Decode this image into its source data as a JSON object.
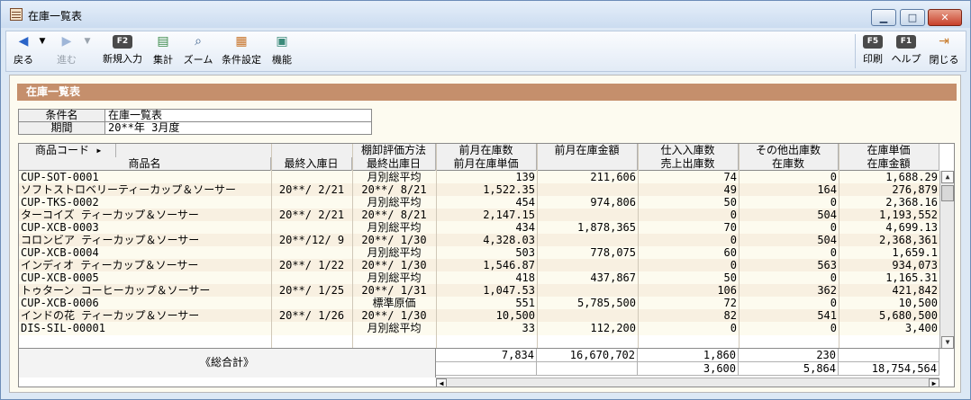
{
  "window": {
    "title": "在庫一覧表"
  },
  "toolbar": {
    "back": "戻る",
    "forward": "進む",
    "new_label": "新規入力",
    "new_key": "F2",
    "sum": "集計",
    "zoom": "ズーム",
    "cond": "条件設定",
    "func": "機能",
    "print": "印刷",
    "print_key": "F5",
    "help": "ヘルプ",
    "help_key": "F1",
    "close": "閉じる"
  },
  "section_title": "在庫一覧表",
  "conditions": [
    {
      "label": "条件名",
      "value": "在庫一覧表"
    },
    {
      "label": "期間",
      "value": "20**年 3月度"
    }
  ],
  "columns_row1": [
    "商品コード ▸",
    "棚卸評価方法",
    "前月在庫数",
    "前月在庫金額",
    "仕入入庫数",
    "その他出庫数",
    "在庫単価"
  ],
  "columns_row2": [
    "商品名",
    "最終入庫日",
    "最終出庫日",
    "前月在庫単価",
    "",
    "売上出庫数",
    "在庫数",
    "在庫金額"
  ],
  "rows": [
    {
      "code": "CUP-SOT-0001",
      "method": "月別総平均",
      "prev_qty": "139",
      "prev_amt": "211,606",
      "in_qty": "74",
      "other_out": "0",
      "unit": "1,688.29",
      "name": "ソフトストロベリーティーカップ＆ソーサー",
      "last_in": "20**/ 2/21",
      "last_out": "20**/ 8/21",
      "prev_unit": "1,522.35",
      "sales_out": "49",
      "stock": "164",
      "stock_amt": "276,879"
    },
    {
      "code": "CUP-TKS-0002",
      "method": "月別総平均",
      "prev_qty": "454",
      "prev_amt": "974,806",
      "in_qty": "50",
      "other_out": "0",
      "unit": "2,368.16",
      "name": "ターコイズ ティーカップ＆ソーサー",
      "last_in": "20**/ 2/21",
      "last_out": "20**/ 8/21",
      "prev_unit": "2,147.15",
      "sales_out": "0",
      "stock": "504",
      "stock_amt": "1,193,552"
    },
    {
      "code": "CUP-XCB-0003",
      "method": "月別総平均",
      "prev_qty": "434",
      "prev_amt": "1,878,365",
      "in_qty": "70",
      "other_out": "0",
      "unit": "4,699.13",
      "name": "コロンビア ティーカップ＆ソーサー",
      "last_in": "20**/12/ 9",
      "last_out": "20**/ 1/30",
      "prev_unit": "4,328.03",
      "sales_out": "0",
      "stock": "504",
      "stock_amt": "2,368,361"
    },
    {
      "code": "CUP-XCB-0004",
      "method": "月別総平均",
      "prev_qty": "503",
      "prev_amt": "778,075",
      "in_qty": "60",
      "other_out": "0",
      "unit": "1,659.1",
      "name": "インディオ ティーカップ＆ソーサー",
      "last_in": "20**/ 1/22",
      "last_out": "20**/ 1/30",
      "prev_unit": "1,546.87",
      "sales_out": "0",
      "stock": "563",
      "stock_amt": "934,073"
    },
    {
      "code": "CUP-XCB-0005",
      "method": "月別総平均",
      "prev_qty": "418",
      "prev_amt": "437,867",
      "in_qty": "50",
      "other_out": "0",
      "unit": "1,165.31",
      "name": "トゥターン コーヒーカップ＆ソーサー",
      "last_in": "20**/ 1/25",
      "last_out": "20**/ 1/31",
      "prev_unit": "1,047.53",
      "sales_out": "106",
      "stock": "362",
      "stock_amt": "421,842"
    },
    {
      "code": "CUP-XCB-0006",
      "method": "標準原価",
      "prev_qty": "551",
      "prev_amt": "5,785,500",
      "in_qty": "72",
      "other_out": "0",
      "unit": "10,500",
      "name": "インドの花 ティーカップ＆ソーサー",
      "last_in": "20**/ 1/26",
      "last_out": "20**/ 1/30",
      "prev_unit": "10,500",
      "sales_out": "82",
      "stock": "541",
      "stock_amt": "5,680,500"
    },
    {
      "code": "DIS-SIL-00001",
      "method": "月別総平均",
      "prev_qty": "33",
      "prev_amt": "112,200",
      "in_qty": "0",
      "other_out": "0",
      "unit": "3,400"
    }
  ],
  "totals": {
    "label": "《総合計》",
    "prev_qty": "7,834",
    "prev_amt": "16,670,702",
    "in_qty": "1,860",
    "other_out": "230",
    "sales_out": "3,600",
    "stock": "5,864",
    "stock_amt": "18,754,564"
  }
}
